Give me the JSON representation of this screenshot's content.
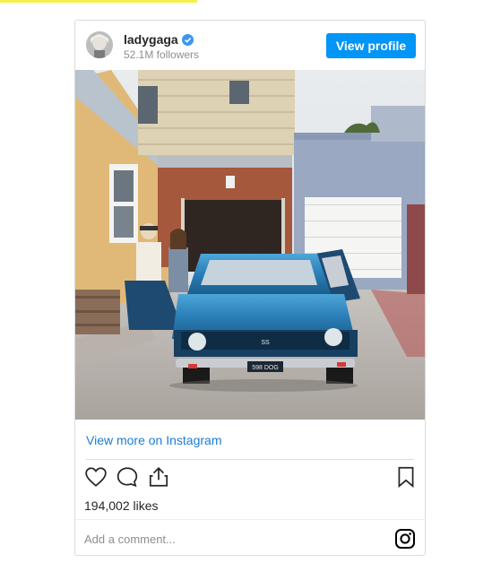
{
  "post": {
    "username": "ladygaga",
    "followers": "52.1M followers",
    "view_profile_label": "View profile",
    "view_more_label": "View more on Instagram",
    "likes": "194,002 likes",
    "comment_placeholder": "Add a comment...",
    "car_plate": "598 DOG",
    "car_badge": "SS"
  },
  "icons": {
    "verified": "verified-badge-icon",
    "like": "heart-icon",
    "comment": "comment-icon",
    "share": "share-icon",
    "save": "bookmark-icon",
    "instagram": "instagram-icon"
  },
  "colors": {
    "accent": "#0095f6",
    "link": "#1b7cd8",
    "border": "#dbdbdb",
    "top_accent": "#f6f04d"
  }
}
